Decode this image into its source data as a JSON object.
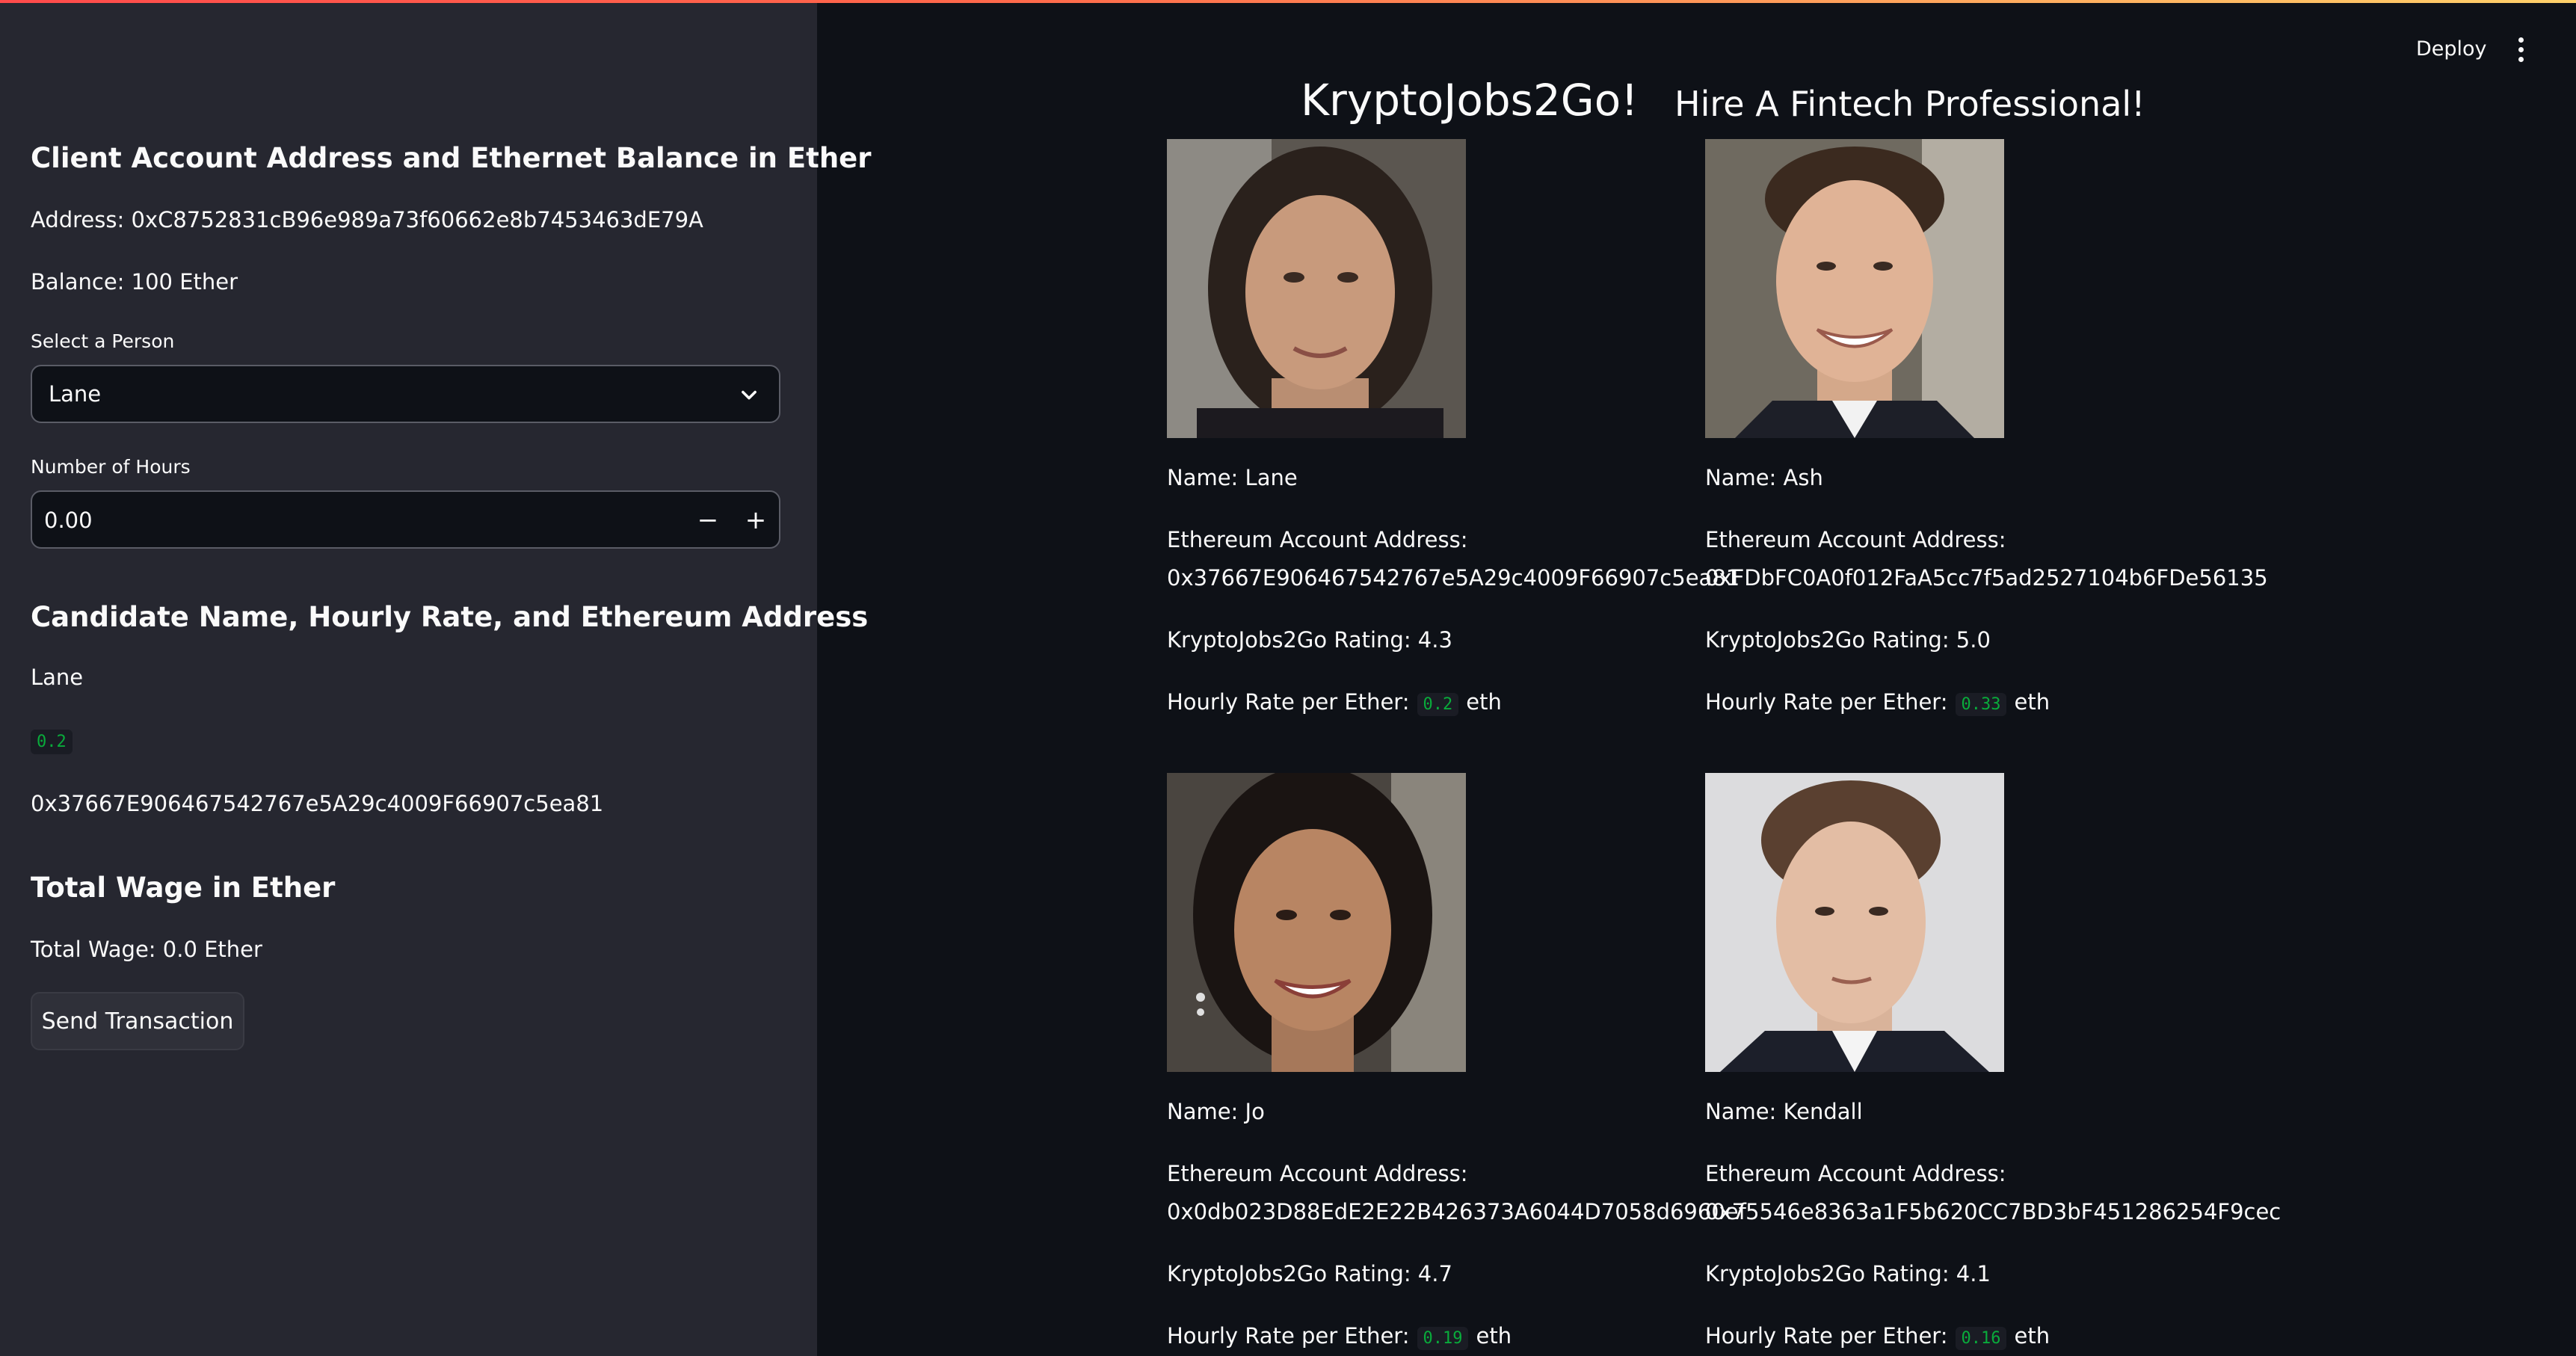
{
  "header": {
    "deploy_label": "Deploy",
    "title": "KryptoJobs2Go!",
    "subtitle": "Hire A Fintech Professional!"
  },
  "sidebar": {
    "client_heading": "Client Account Address and Ethernet Balance in Ether",
    "address_text": "Address: 0xC8752831cB96e989a73f60662e8b7453463dE79A",
    "balance_text": "Balance: 100 Ether",
    "select_label": "Select a Person",
    "select_value": "Lane",
    "hours_label": "Number of Hours",
    "hours_value": "0.00",
    "candidate_heading": "Candidate Name, Hourly Rate, and Ethereum Address",
    "candidate_name": "Lane",
    "candidate_rate": "0.2",
    "candidate_address": "0x37667E906467542767e5A29c4009F66907c5ea81",
    "wage_heading": "Total Wage in Ether",
    "wage_text": "Total Wage: 0.0 Ether",
    "send_label": "Send Transaction"
  },
  "candidates": [
    {
      "name": "Name: Lane",
      "address_label": "Ethereum Account Address:",
      "address": "0x37667E906467542767e5A29c4009F66907c5ea81",
      "rating": "KryptoJobs2Go Rating: 4.3",
      "rate_label": "Hourly Rate per Ether:",
      "rate": "0.2",
      "rate_unit": "eth"
    },
    {
      "name": "Name: Ash",
      "address_label": "Ethereum Account Address:",
      "address": "0xFDbFC0A0f012FaA5cc7f5ad2527104b6FDe56135",
      "rating": "KryptoJobs2Go Rating: 5.0",
      "rate_label": "Hourly Rate per Ether:",
      "rate": "0.33",
      "rate_unit": "eth"
    },
    {
      "name": "Name: Jo",
      "address_label": "Ethereum Account Address:",
      "address": "0x0db023D88EdE2E22B426373A6044D7058d6960ef",
      "rating": "KryptoJobs2Go Rating: 4.7",
      "rate_label": "Hourly Rate per Ether:",
      "rate": "0.19",
      "rate_unit": "eth"
    },
    {
      "name": "Name: Kendall",
      "address_label": "Ethereum Account Address:",
      "address": "0x75546e8363a1F5b620CC7BD3bF451286254F9cec",
      "rating": "KryptoJobs2Go Rating: 4.1",
      "rate_label": "Hourly Rate per Ether:",
      "rate": "0.16",
      "rate_unit": "eth"
    }
  ]
}
